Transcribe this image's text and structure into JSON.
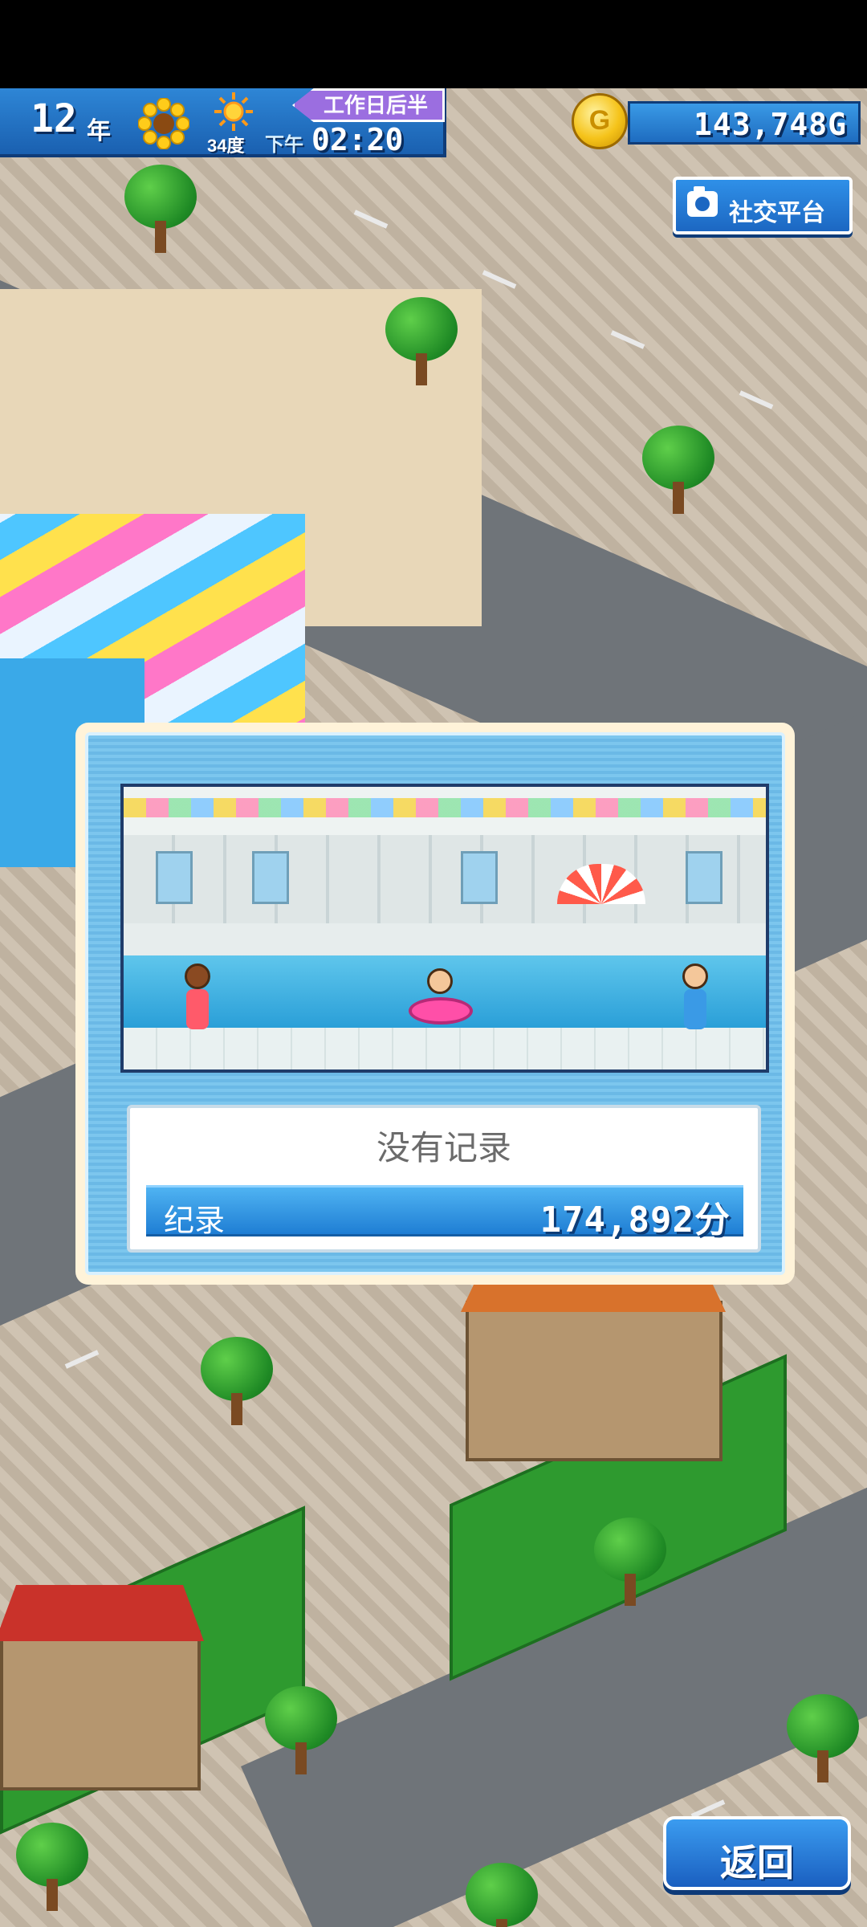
{
  "hud": {
    "year": "12",
    "year_unit": "年",
    "temperature": "34度",
    "ampm": "下午",
    "time": "02:20",
    "period": "工作日后半",
    "money": "143,748G"
  },
  "social_button": {
    "label": "社交平台"
  },
  "record_dialog": {
    "status": "没有记录",
    "record_label": "纪录",
    "record_score": "174,892分"
  },
  "back_button": {
    "label": "返回"
  },
  "colors": {
    "hud_blue": "#2e86d6",
    "dialog_blue": "#7cc6ee",
    "accent_purple": "#9b6ee0",
    "coin_gold": "#f5c31a"
  },
  "icons": [
    "sunflower-icon",
    "sun-icon",
    "coin-icon",
    "camera-icon"
  ]
}
